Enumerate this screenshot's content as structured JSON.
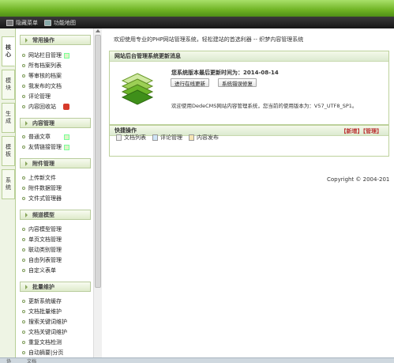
{
  "toolbar": {
    "hide_menu": "隐藏菜单",
    "function_map": "功能地图"
  },
  "vtabs": [
    "核心",
    "模块",
    "生成",
    "模板",
    "系统"
  ],
  "sidebar": {
    "groups": [
      {
        "title": "常用操作",
        "items": [
          "网站栏目管理",
          "所有档案列表",
          "等审核的档案",
          "我发布的文档",
          "评论管理",
          "内容回收站"
        ]
      },
      {
        "title": "内容管理",
        "items": [
          "普通文章",
          "友情链接管理"
        ]
      },
      {
        "title": "附件管理",
        "items": [
          "上传新文件",
          "附件数据管理",
          "文件式管理器"
        ]
      },
      {
        "title": "频道模型",
        "items": [
          "内容模型管理",
          "单页文档管理",
          "联动类别管理",
          "自由列表管理",
          "自定义表单"
        ]
      },
      {
        "title": "批量维护",
        "items": [
          "更新系统缓存",
          "文档批量维护",
          "搜索关键词维护",
          "文档关键词维护",
          "重复文档检测",
          "自动摘要|分页"
        ]
      }
    ]
  },
  "main": {
    "welcome": "欢迎使用专业的PHP网站管理系统，轻松建站的首选利器 -- 织梦内容管理系统",
    "update_panel": {
      "title": "网站后台管理系统更新消息",
      "version_line": "您系统版本最后更新时间为：2014-08-14",
      "btn_online_update": "进行在线更新",
      "btn_error_fix": "系统错误修复",
      "desc": "欢迎使用DedeCMS网站内容管理系统，您当前的使用版本为：V57_UTF8_SP1。"
    },
    "quick_panel": {
      "title": "快捷操作",
      "links": "【新增】【管理】",
      "items": [
        "文档列表",
        "评论管理",
        "内容发布"
      ]
    },
    "copyright": "Copyright © 2004-201"
  },
  "bottom": {
    "left": "协",
    "right": "文档"
  }
}
